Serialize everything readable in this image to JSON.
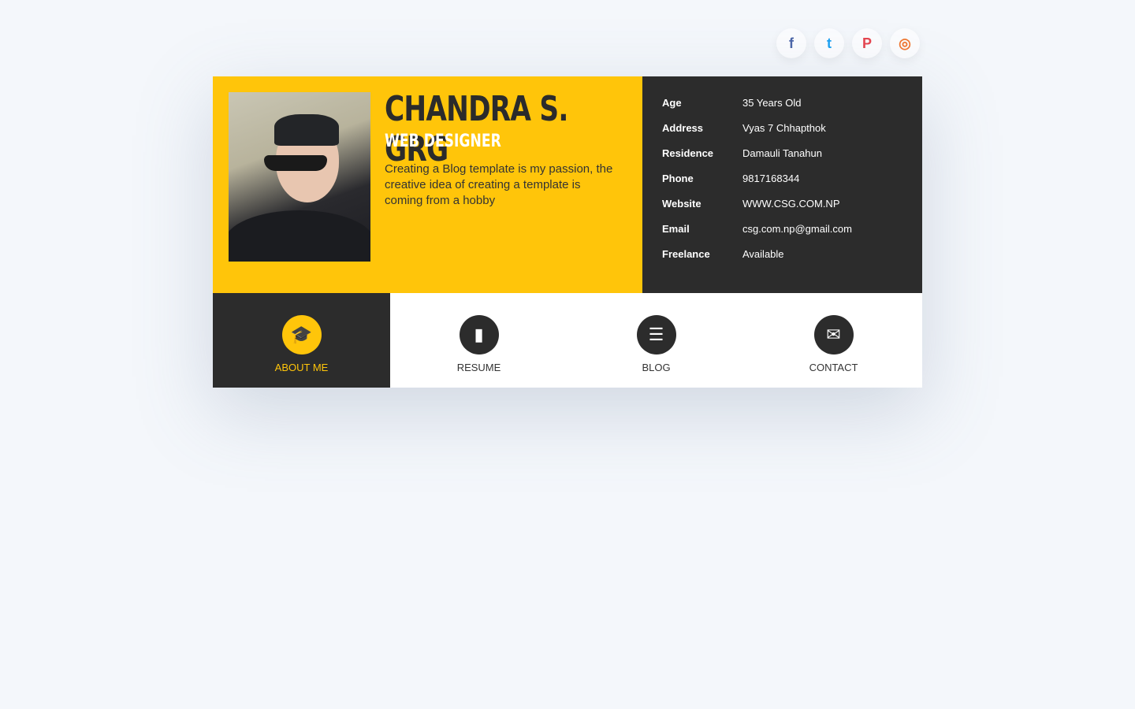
{
  "social": [
    {
      "name": "facebook",
      "glyph": "f",
      "color": "#4b66a8"
    },
    {
      "name": "twitter",
      "glyph": "t",
      "color": "#1da1f2"
    },
    {
      "name": "pinterest",
      "glyph": "P",
      "color": "#e5454f"
    },
    {
      "name": "instagram",
      "glyph": "◎",
      "color": "#f07833"
    }
  ],
  "profile": {
    "name": "CHANDRA S. GRG",
    "role": "WEB DESIGNER",
    "bio": "Creating a Blog template is my passion, the creative idea of creating a template is coming from a hobby"
  },
  "info": [
    {
      "label": "Age",
      "value": "35 Years Old"
    },
    {
      "label": "Address",
      "value": "Vyas 7 Chhapthok"
    },
    {
      "label": "Residence",
      "value": "Damauli Tanahun"
    },
    {
      "label": "Phone",
      "value": "9817168344"
    },
    {
      "label": "Website",
      "value": "WWW.CSG.COM.NP"
    },
    {
      "label": "Email",
      "value": "csg.com.np@gmail.com"
    },
    {
      "label": "Freelance",
      "value": "Available"
    }
  ],
  "nav": [
    {
      "label": "ABOUT ME",
      "icon": "user-graduate-icon",
      "glyph": "🎓",
      "active": true
    },
    {
      "label": "RESUME",
      "icon": "file-contact-icon",
      "glyph": "▮"
    },
    {
      "label": "BLOG",
      "icon": "newspaper-icon",
      "glyph": "☰"
    },
    {
      "label": "CONTACT",
      "icon": "envelope-icon",
      "glyph": "✉"
    }
  ],
  "colors": {
    "accent": "#ffc50a",
    "dark": "#2c2c2c",
    "background": "#f4f7fb"
  }
}
